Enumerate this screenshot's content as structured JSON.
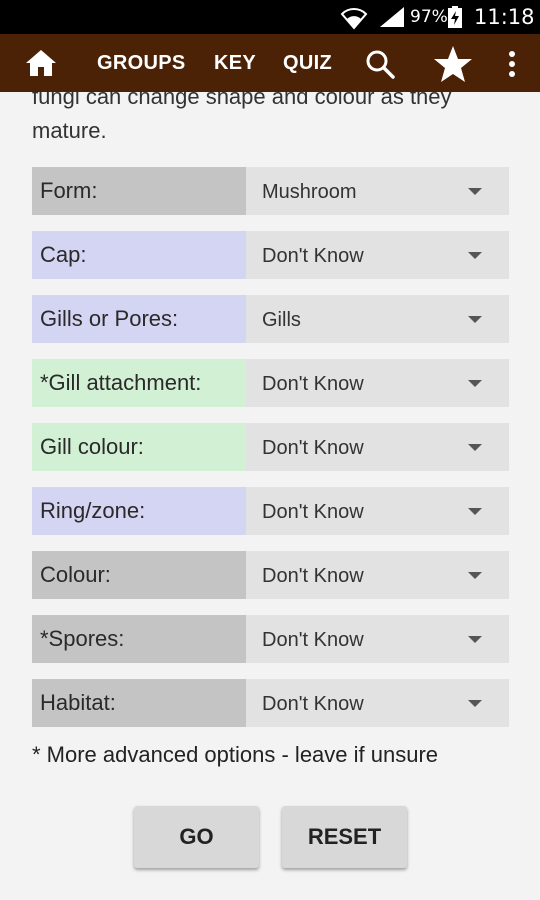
{
  "status_bar": {
    "battery_percent": "97%",
    "time": "11:18"
  },
  "toolbar": {
    "items": [
      "GROUPS",
      "KEY",
      "QUIZ"
    ]
  },
  "intro_text": "fungi can change shape and colour as they mature.",
  "fields": [
    {
      "label": "Form:",
      "value": "Mushroom",
      "label_color": "#c4c4c4"
    },
    {
      "label": "Cap:",
      "value": "Don't Know",
      "label_color": "#d4d4f3"
    },
    {
      "label": "Gills or Pores:",
      "value": "Gills",
      "label_color": "#d4d4f3"
    },
    {
      "label": "*Gill attachment:",
      "value": "Don't Know",
      "label_color": "#d2f0d4"
    },
    {
      "label": "Gill colour:",
      "value": "Don't Know",
      "label_color": "#d2f0d4"
    },
    {
      "label": "Ring/zone:",
      "value": "Don't Know",
      "label_color": "#d4d4f3"
    },
    {
      "label": "Colour:",
      "value": "Don't Know",
      "label_color": "#c4c4c4"
    },
    {
      "label": "*Spores:",
      "value": "Don't Know",
      "label_color": "#c4c4c4"
    },
    {
      "label": "Habitat:",
      "value": "Don't Know",
      "label_color": "#c4c4c4"
    }
  ],
  "footnote": "* More advanced options - leave if unsure",
  "buttons": {
    "go": "GO",
    "reset": "RESET"
  },
  "colors": {
    "toolbar": "#4b2206",
    "status_bar": "#000000",
    "select_bg": "#e2e2e2"
  }
}
